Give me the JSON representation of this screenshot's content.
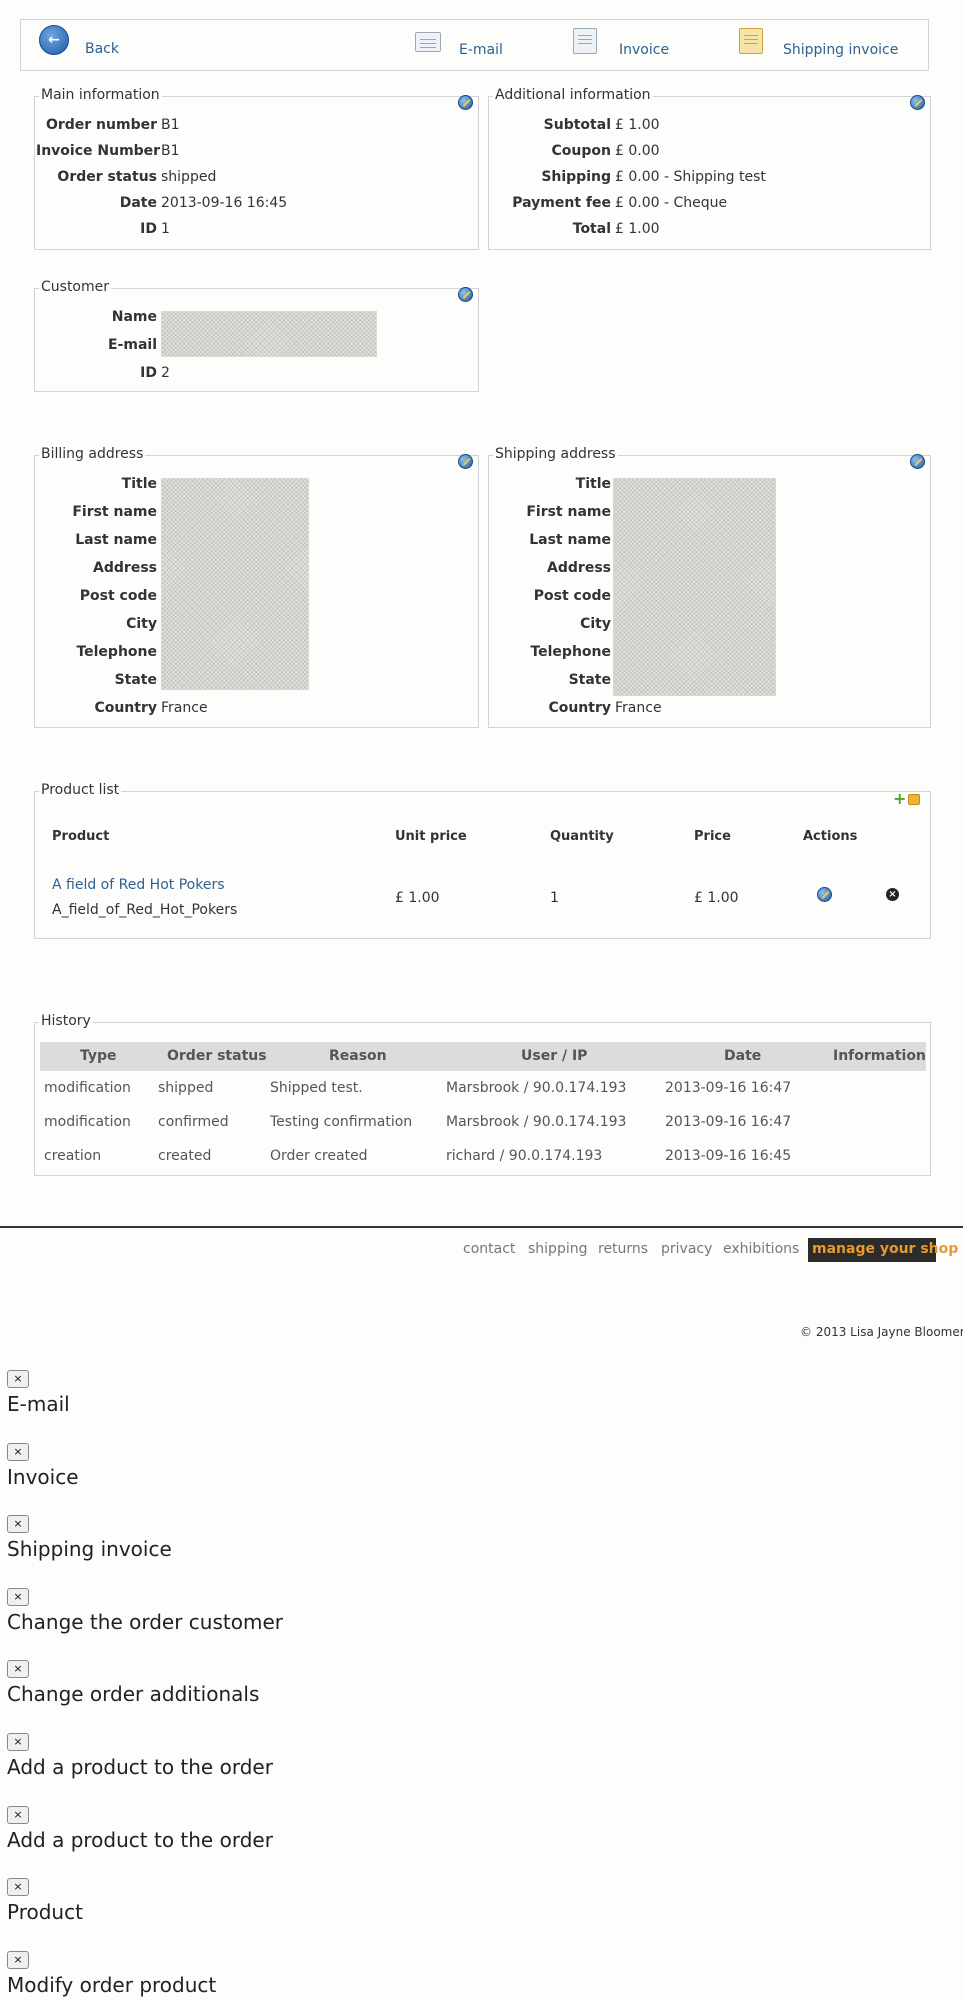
{
  "toolbar": {
    "back": "Back",
    "email": "E-mail",
    "invoice": "Invoice",
    "shipping_invoice": "Shipping invoice"
  },
  "main_info": {
    "title": "Main information",
    "rows": [
      {
        "k": "Order number",
        "v": "B1"
      },
      {
        "k": "Invoice Number",
        "v": "B1"
      },
      {
        "k": "Order status",
        "v": "shipped"
      },
      {
        "k": "Date",
        "v": "2013-09-16 16:45"
      },
      {
        "k": "ID",
        "v": "1"
      }
    ]
  },
  "additional_info": {
    "title": "Additional information",
    "rows": [
      {
        "k": "Subtotal",
        "v": "£ 1.00"
      },
      {
        "k": "Coupon",
        "v": "£ 0.00"
      },
      {
        "k": "Shipping",
        "v": "£ 0.00 - Shipping test"
      },
      {
        "k": "Payment fee",
        "v": "£ 0.00 - Cheque"
      },
      {
        "k": "Total",
        "v": "£ 1.00"
      }
    ]
  },
  "customer": {
    "title": "Customer",
    "rows": [
      {
        "k": "Name",
        "v": ""
      },
      {
        "k": "E-mail",
        "v": ""
      },
      {
        "k": "ID",
        "v": "2"
      }
    ]
  },
  "billing": {
    "title": "Billing address",
    "labels": [
      "Title",
      "First name",
      "Last name",
      "Address",
      "Post code",
      "City",
      "Telephone",
      "State",
      "Country"
    ],
    "country": "France"
  },
  "shipping": {
    "title": "Shipping address",
    "labels": [
      "Title",
      "First name",
      "Last name",
      "Address",
      "Post code",
      "City",
      "Telephone",
      "State",
      "Country"
    ],
    "country": "France"
  },
  "products": {
    "title": "Product list",
    "headers": [
      "Product",
      "Unit price",
      "Quantity",
      "Price",
      "Actions"
    ],
    "rows": [
      {
        "name": "A field of Red Hot Pokers",
        "code": "A_field_of_Red_Hot_Pokers",
        "unit_price": "£ 1.00",
        "quantity": "1",
        "price": "£ 1.00"
      }
    ]
  },
  "history": {
    "title": "History",
    "headers": [
      "Type",
      "Order status",
      "Reason",
      "User / IP",
      "Date",
      "Information"
    ],
    "rows": [
      [
        "modification",
        "shipped",
        "Shipped test.",
        "Marsbrook / 90.0.174.193",
        "2013-09-16 16:47",
        ""
      ],
      [
        "modification",
        "confirmed",
        "Testing confirmation",
        "Marsbrook / 90.0.174.193",
        "2013-09-16 16:47",
        ""
      ],
      [
        "creation",
        "created",
        "Order created",
        "richard / 90.0.174.193",
        "2013-09-16 16:45",
        ""
      ]
    ]
  },
  "footer": {
    "links": [
      "contact",
      "shipping",
      "returns",
      "privacy",
      "exhibitions"
    ],
    "manage": "manage your shop",
    "copyright": "© 2013 Lisa Jayne Bloomer"
  },
  "dialogs": {
    "close_glyph": "×",
    "titles": [
      "E-mail",
      "Invoice",
      "Shipping invoice",
      "Change the order customer",
      "Change order additionals",
      "Add a product to the order",
      "Add a product to the order",
      "Product",
      "Modify order product"
    ]
  }
}
